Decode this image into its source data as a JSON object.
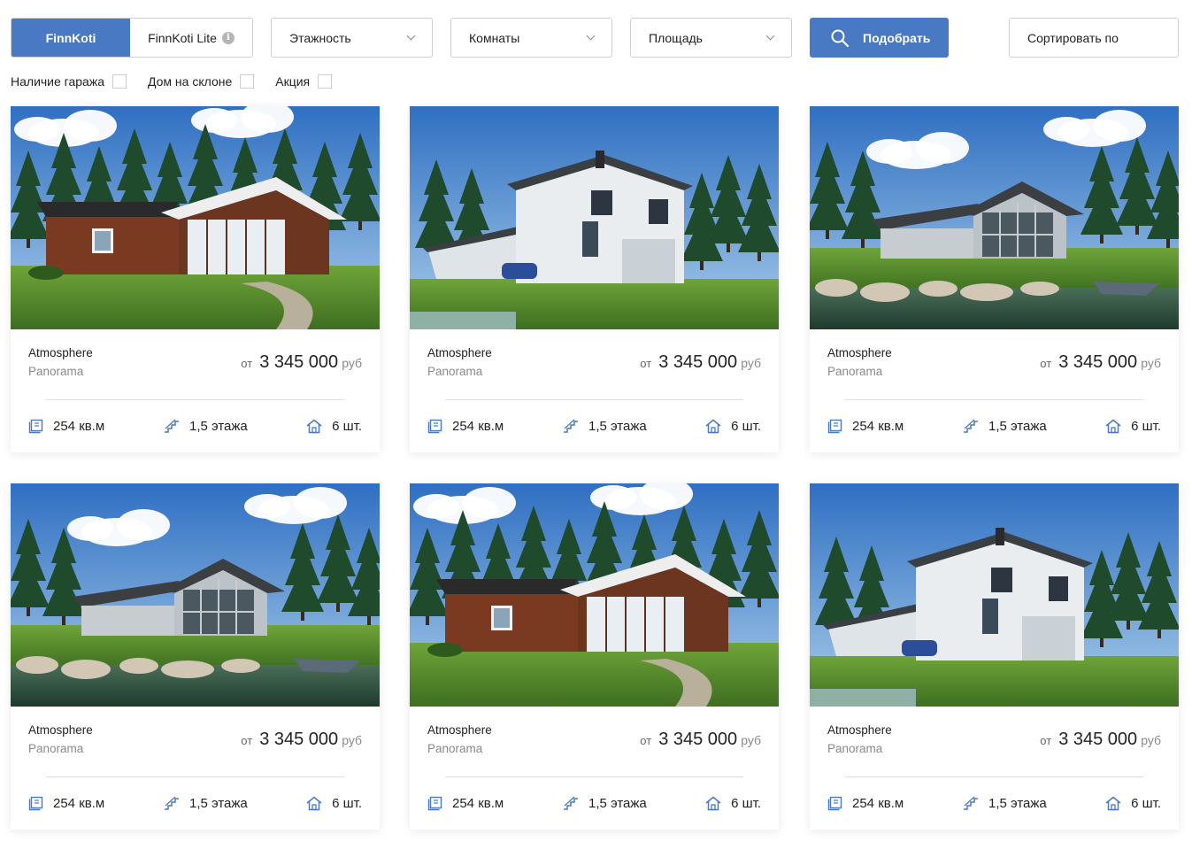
{
  "filters": {
    "tabs": [
      {
        "label": "FinnKoti",
        "active": true
      },
      {
        "label": "FinnKoti Lite",
        "active": false
      }
    ],
    "selects": [
      {
        "label": "Этажность"
      },
      {
        "label": "Комнаты"
      },
      {
        "label": "Площадь"
      }
    ],
    "search_label": "Подобрать",
    "sort_label": "Сортировать по",
    "checkboxes": [
      {
        "label": "Наличие гаража",
        "checked": false
      },
      {
        "label": "Дом на склоне",
        "checked": false
      },
      {
        "label": "Акция",
        "checked": false
      }
    ]
  },
  "colors": {
    "accent": "#4a79c3",
    "icon": "#4a79c3"
  },
  "cards": [
    {
      "image": "dark-wood-bungalow",
      "name": "Atmosphere",
      "sub": "Panorama",
      "price_from": "от",
      "price": "3 345 000",
      "currency": "руб",
      "area": "254 кв.м",
      "floors": "1,5 этажа",
      "rooms": "6 шт."
    },
    {
      "image": "white-two-storey-carport",
      "name": "Atmosphere",
      "sub": "Panorama",
      "price_from": "от",
      "price": "3 345 000",
      "currency": "руб",
      "area": "254 кв.м",
      "floors": "1,5 этажа",
      "rooms": "6 шт."
    },
    {
      "image": "grey-lakeside-house",
      "name": "Atmosphere",
      "sub": "Panorama",
      "price_from": "от",
      "price": "3 345 000",
      "currency": "руб",
      "area": "254 кв.м",
      "floors": "1,5 этажа",
      "rooms": "6 шт."
    },
    {
      "image": "grey-lakeside-house",
      "name": "Atmosphere",
      "sub": "Panorama",
      "price_from": "от",
      "price": "3 345 000",
      "currency": "руб",
      "area": "254 кв.м",
      "floors": "1,5 этажа",
      "rooms": "6 шт."
    },
    {
      "image": "dark-wood-bungalow",
      "name": "Atmosphere",
      "sub": "Panorama",
      "price_from": "от",
      "price": "3 345 000",
      "currency": "руб",
      "area": "254 кв.м",
      "floors": "1,5 этажа",
      "rooms": "6 шт."
    },
    {
      "image": "white-two-storey-carport",
      "name": "Atmosphere",
      "sub": "Panorama",
      "price_from": "от",
      "price": "3 345 000",
      "currency": "руб",
      "area": "254 кв.м",
      "floors": "1,5 этажа",
      "rooms": "6 шт."
    }
  ]
}
